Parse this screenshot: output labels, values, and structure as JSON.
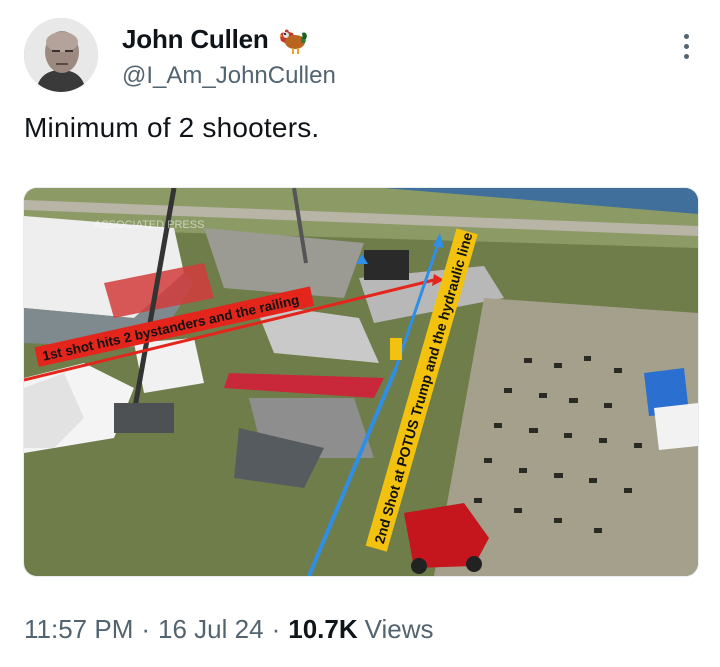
{
  "author": {
    "name": "John Cullen",
    "handle": "@I_Am_JohnCullen",
    "badge_icon": "rooster-emoji-icon"
  },
  "tweet": {
    "text": "Minimum of 2 shooters."
  },
  "media": {
    "watermark": "ASSOCIATED PRESS",
    "annotation_red": "1st shot hits 2 bystanders and the railing",
    "annotation_yellow": "2nd Shot at POTUS Trump  and the hydraulic line",
    "line_colors": {
      "red": "#e3251c",
      "blue": "#2f8fe6",
      "yellow": "#f2c20f"
    }
  },
  "meta": {
    "time": "11:57 PM",
    "separator": "·",
    "date": "16 Jul 24",
    "views_count": "10.7K",
    "views_label": "Views"
  },
  "colors": {
    "text": "#0f1419",
    "secondary": "#536471"
  }
}
